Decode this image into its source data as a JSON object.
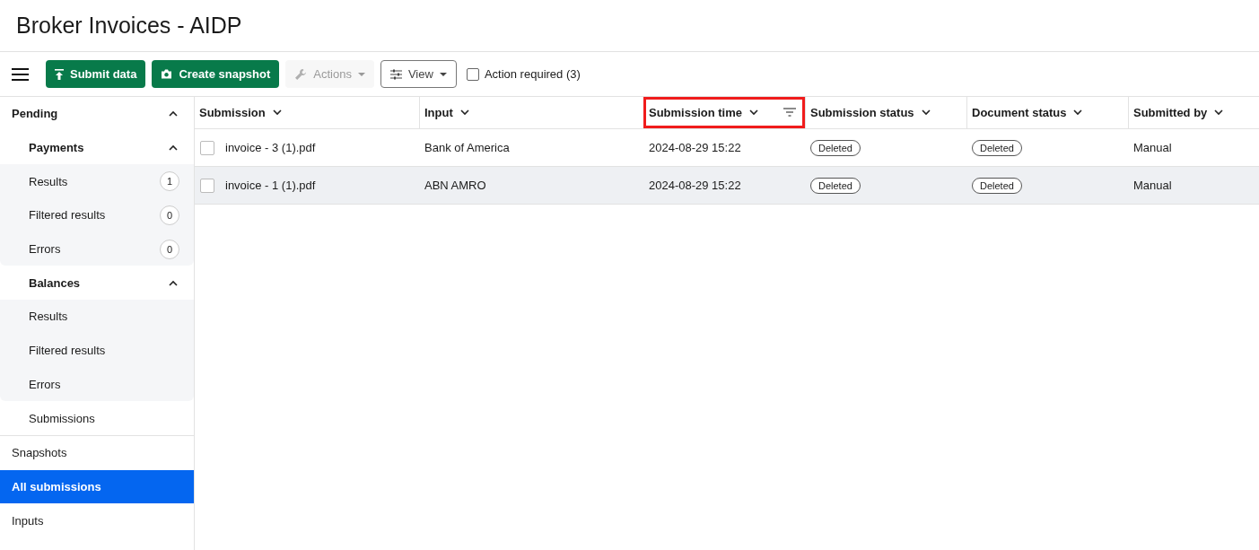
{
  "page_title": "Broker Invoices - AIDP",
  "toolbar": {
    "buttons": [
      {
        "kind": "primary",
        "label": "Submit data",
        "disabled": false
      },
      {
        "kind": "primary",
        "label": "Create snapshot",
        "disabled": false
      },
      {
        "kind": "menu",
        "label": "Actions",
        "disabled": true
      },
      {
        "kind": "outline",
        "label": "View",
        "disabled": false
      }
    ],
    "checkbox": {
      "label": "Action required (3)",
      "checked": false
    }
  },
  "sidebar": {
    "items": [
      {
        "label": "Pending",
        "expanded": true,
        "selected": false,
        "children": [
          {
            "label": "Payments",
            "expanded": true,
            "selected": false,
            "children": [
              {
                "label": "Results",
                "badge": "1",
                "selected": false
              },
              {
                "label": "Filtered results",
                "badge": "0",
                "selected": false
              },
              {
                "label": "Errors",
                "badge": "0",
                "selected": false
              }
            ]
          },
          {
            "label": "Balances",
            "expanded": true,
            "selected": false,
            "children": [
              {
                "label": "Results",
                "selected": false
              },
              {
                "label": "Filtered results",
                "selected": false
              },
              {
                "label": "Errors",
                "selected": false
              }
            ]
          },
          {
            "label": "Submissions",
            "selected": false
          }
        ]
      },
      {
        "label": "Snapshots",
        "selected": false
      },
      {
        "label": "All submissions",
        "selected": true
      },
      {
        "label": "Inputs",
        "selected": false
      }
    ]
  },
  "table": {
    "columns": [
      {
        "label": "Submission",
        "highlighted": false,
        "filter": false
      },
      {
        "label": "Input",
        "highlighted": false,
        "filter": false
      },
      {
        "label": "Submission time",
        "highlighted": true,
        "filter": true
      },
      {
        "label": "Submission status",
        "highlighted": false,
        "filter": false
      },
      {
        "label": "Document status",
        "highlighted": false,
        "filter": false
      },
      {
        "label": "Submitted by",
        "highlighted": false,
        "filter": false
      }
    ],
    "rows": [
      {
        "checked": false,
        "hovered": false,
        "cells": [
          "invoice - 3 (1).pdf",
          "Bank of America",
          "2024-08-29 15:22",
          "Deleted",
          "Deleted",
          "Manual"
        ]
      },
      {
        "checked": false,
        "hovered": true,
        "cells": [
          "invoice - 1 (1).pdf",
          "ABN AMRO",
          "2024-08-29 15:22",
          "Deleted",
          "Deleted",
          "Manual"
        ]
      }
    ]
  }
}
